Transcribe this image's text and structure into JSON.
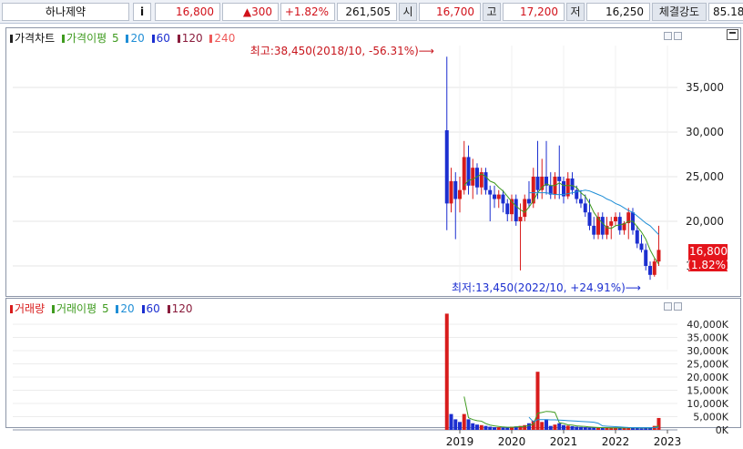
{
  "quote_bar": {
    "stock_name": "하나제약",
    "info_button": "i",
    "price": "16,800",
    "change": "▲300",
    "change_pct": "+1.82%",
    "volume": "261,505",
    "open_label": "시",
    "open": "16,700",
    "high_label": "고",
    "high": "17,200",
    "low_label": "저",
    "low": "16,250",
    "strength_label": "체결강도",
    "strength": "85.18"
  },
  "price_panel": {
    "legend": {
      "chart_label": "가격차트",
      "ma_label": "가격이평",
      "periods": [
        "5",
        "20",
        "60",
        "120",
        "240"
      ]
    },
    "annotations": {
      "high": "최고:38,450(2018/10, -56.31%)⟶",
      "low": "최저:13,450(2022/10, +24.91%)⟶",
      "current_price": "16,800",
      "current_change": "(1.82%)"
    }
  },
  "volume_panel": {
    "legend": {
      "chart_label": "거래량",
      "ma_label": "거래이평",
      "periods": [
        "5",
        "20",
        "60",
        "120"
      ]
    }
  },
  "colors": {
    "up": "#d81c1c",
    "down": "#1c2fd0",
    "ma5": "#3f9b1f",
    "ma20": "#1f8ed6",
    "ma60": "#1c2fd0",
    "ma120": "#8a1c3c",
    "ma240": "#ee5a5a",
    "current_bg": "#e4141b"
  },
  "chart_data": [
    {
      "type": "candlestick",
      "title": "가격차트",
      "x_ticks": [
        "2019",
        "2020",
        "2021",
        "2022",
        "2023"
      ],
      "y_ticks": [
        15000,
        20000,
        25000,
        30000,
        35000
      ],
      "ylim": [
        13000,
        38800
      ],
      "period": "monthly",
      "candles": [
        {
          "t": 2018.75,
          "o": 30200,
          "h": 38450,
          "l": 19000,
          "c": 22000
        },
        {
          "t": 2018.833,
          "o": 22000,
          "h": 26000,
          "l": 21000,
          "c": 24500
        },
        {
          "t": 2018.917,
          "o": 24500,
          "h": 25500,
          "l": 18000,
          "c": 22500
        },
        {
          "t": 2019.0,
          "o": 22500,
          "h": 25000,
          "l": 21000,
          "c": 23500
        },
        {
          "t": 2019.083,
          "o": 23500,
          "h": 29000,
          "l": 23000,
          "c": 27200
        },
        {
          "t": 2019.167,
          "o": 27200,
          "h": 28500,
          "l": 23000,
          "c": 24000
        },
        {
          "t": 2019.25,
          "o": 24000,
          "h": 27000,
          "l": 22500,
          "c": 26000
        },
        {
          "t": 2019.333,
          "o": 26000,
          "h": 26500,
          "l": 23000,
          "c": 23800
        },
        {
          "t": 2019.417,
          "o": 23800,
          "h": 26000,
          "l": 23000,
          "c": 25500
        },
        {
          "t": 2019.5,
          "o": 25500,
          "h": 26000,
          "l": 23000,
          "c": 23500
        },
        {
          "t": 2019.583,
          "o": 23500,
          "h": 24000,
          "l": 20000,
          "c": 23000
        },
        {
          "t": 2019.667,
          "o": 23000,
          "h": 24000,
          "l": 21500,
          "c": 22500
        },
        {
          "t": 2019.75,
          "o": 22500,
          "h": 23500,
          "l": 21500,
          "c": 23000
        },
        {
          "t": 2019.833,
          "o": 23000,
          "h": 23500,
          "l": 21000,
          "c": 22000
        },
        {
          "t": 2019.917,
          "o": 22000,
          "h": 22500,
          "l": 20000,
          "c": 20800
        },
        {
          "t": 2020.0,
          "o": 20800,
          "h": 23000,
          "l": 20000,
          "c": 22500
        },
        {
          "t": 2020.083,
          "o": 22500,
          "h": 23000,
          "l": 19500,
          "c": 20000
        },
        {
          "t": 2020.167,
          "o": 20000,
          "h": 22000,
          "l": 14500,
          "c": 20500
        },
        {
          "t": 2020.25,
          "o": 20500,
          "h": 23000,
          "l": 20000,
          "c": 22500
        },
        {
          "t": 2020.333,
          "o": 22500,
          "h": 24500,
          "l": 21500,
          "c": 22000
        },
        {
          "t": 2020.417,
          "o": 22000,
          "h": 26000,
          "l": 21500,
          "c": 25000
        },
        {
          "t": 2020.5,
          "o": 25000,
          "h": 29000,
          "l": 22500,
          "c": 23500
        },
        {
          "t": 2020.583,
          "o": 23500,
          "h": 27000,
          "l": 22500,
          "c": 25000
        },
        {
          "t": 2020.667,
          "o": 25000,
          "h": 29000,
          "l": 23000,
          "c": 24000
        },
        {
          "t": 2020.75,
          "o": 24000,
          "h": 25500,
          "l": 22500,
          "c": 23000
        },
        {
          "t": 2020.833,
          "o": 23000,
          "h": 25500,
          "l": 22500,
          "c": 25000
        },
        {
          "t": 2020.917,
          "o": 25000,
          "h": 28500,
          "l": 22500,
          "c": 24500
        },
        {
          "t": 2021.0,
          "o": 24500,
          "h": 25000,
          "l": 22000,
          "c": 22800
        },
        {
          "t": 2021.083,
          "o": 22800,
          "h": 25500,
          "l": 22500,
          "c": 24800
        },
        {
          "t": 2021.167,
          "o": 24800,
          "h": 25500,
          "l": 23000,
          "c": 23500
        },
        {
          "t": 2021.25,
          "o": 23500,
          "h": 24000,
          "l": 22000,
          "c": 22500
        },
        {
          "t": 2021.333,
          "o": 22500,
          "h": 23500,
          "l": 21500,
          "c": 22000
        },
        {
          "t": 2021.417,
          "o": 22000,
          "h": 23000,
          "l": 20500,
          "c": 21000
        },
        {
          "t": 2021.5,
          "o": 21000,
          "h": 22500,
          "l": 19000,
          "c": 19500
        },
        {
          "t": 2021.583,
          "o": 19500,
          "h": 20500,
          "l": 18000,
          "c": 18500
        },
        {
          "t": 2021.667,
          "o": 18500,
          "h": 21000,
          "l": 18000,
          "c": 20500
        },
        {
          "t": 2021.75,
          "o": 20500,
          "h": 21000,
          "l": 18000,
          "c": 18500
        },
        {
          "t": 2021.833,
          "o": 18500,
          "h": 20500,
          "l": 18000,
          "c": 19500
        },
        {
          "t": 2021.917,
          "o": 19500,
          "h": 20500,
          "l": 18000,
          "c": 20000
        },
        {
          "t": 2022.0,
          "o": 20000,
          "h": 21000,
          "l": 19500,
          "c": 20500
        },
        {
          "t": 2022.083,
          "o": 20500,
          "h": 21000,
          "l": 18500,
          "c": 19000
        },
        {
          "t": 2022.167,
          "o": 19000,
          "h": 20000,
          "l": 18500,
          "c": 19800
        },
        {
          "t": 2022.25,
          "o": 19800,
          "h": 21500,
          "l": 18000,
          "c": 21000
        },
        {
          "t": 2022.333,
          "o": 21000,
          "h": 21500,
          "l": 18500,
          "c": 19000
        },
        {
          "t": 2022.417,
          "o": 19000,
          "h": 19500,
          "l": 17000,
          "c": 17500
        },
        {
          "t": 2022.5,
          "o": 17500,
          "h": 18500,
          "l": 16500,
          "c": 16800
        },
        {
          "t": 2022.583,
          "o": 16800,
          "h": 17500,
          "l": 14500,
          "c": 15000
        },
        {
          "t": 2022.667,
          "o": 15000,
          "h": 15500,
          "l": 13450,
          "c": 14000
        },
        {
          "t": 2022.75,
          "o": 14000,
          "h": 15800,
          "l": 13800,
          "c": 15500
        },
        {
          "t": 2022.833,
          "o": 15500,
          "h": 19500,
          "l": 15000,
          "c": 16800
        }
      ],
      "moving_averages": [
        {
          "name": "5",
          "values": [
            null,
            null,
            null,
            null,
            24000,
            24600,
            24700,
            25000,
            25300,
            25000,
            24500,
            24300,
            23800,
            23400,
            22800,
            22200,
            21700,
            21300,
            21000,
            21600,
            22300,
            23200,
            23800,
            24200,
            24000,
            24000,
            24300,
            24000,
            24000,
            24000,
            23800,
            23200,
            22800,
            22000,
            21000,
            20300,
            19800,
            19300,
            19200,
            19500,
            19600,
            19700,
            20000,
            20000,
            19400,
            18800,
            18000,
            16800,
            15900,
            15200
          ]
        },
        {
          "name": "20",
          "values": [
            null,
            null,
            null,
            null,
            null,
            null,
            null,
            null,
            null,
            null,
            null,
            null,
            null,
            null,
            null,
            null,
            null,
            null,
            null,
            23200,
            23200,
            23200,
            23200,
            23200,
            23100,
            23000,
            23000,
            23000,
            23100,
            23200,
            23300,
            23400,
            23500,
            23400,
            23200,
            23000,
            22800,
            22500,
            22300,
            22000,
            21800,
            21500,
            21200,
            21000,
            20600,
            20200,
            19800,
            19500,
            19000,
            18500
          ]
        },
        {
          "name": "60",
          "values": []
        },
        {
          "name": "120",
          "values": []
        },
        {
          "name": "240",
          "values": []
        }
      ]
    },
    {
      "type": "bar",
      "title": "거래량",
      "x_ticks": [
        "2019",
        "2020",
        "2021",
        "2022",
        "2023"
      ],
      "y_ticks": [
        "0K",
        "5,000K",
        "10,000K",
        "15,000K",
        "20,000K",
        "25,000K",
        "30,000K",
        "35,000K",
        "40,000K"
      ],
      "ylim": [
        0,
        45000
      ],
      "unit": "K",
      "bars": [
        {
          "t": 2018.75,
          "v": 44000,
          "up": true
        },
        {
          "t": 2018.833,
          "v": 6000,
          "up": false
        },
        {
          "t": 2018.917,
          "v": 4000,
          "up": false
        },
        {
          "t": 2019.0,
          "v": 3000,
          "up": false
        },
        {
          "t": 2019.083,
          "v": 6000,
          "up": true
        },
        {
          "t": 2019.167,
          "v": 4000,
          "up": false
        },
        {
          "t": 2019.25,
          "v": 2500,
          "up": false
        },
        {
          "t": 2019.333,
          "v": 2000,
          "up": false
        },
        {
          "t": 2019.417,
          "v": 1800,
          "up": true
        },
        {
          "t": 2019.5,
          "v": 1500,
          "up": false
        },
        {
          "t": 2019.583,
          "v": 1200,
          "up": false
        },
        {
          "t": 2019.667,
          "v": 1000,
          "up": false
        },
        {
          "t": 2019.75,
          "v": 1000,
          "up": true
        },
        {
          "t": 2019.833,
          "v": 900,
          "up": false
        },
        {
          "t": 2019.917,
          "v": 900,
          "up": false
        },
        {
          "t": 2020.0,
          "v": 1200,
          "up": true
        },
        {
          "t": 2020.083,
          "v": 1300,
          "up": false
        },
        {
          "t": 2020.167,
          "v": 1500,
          "up": true
        },
        {
          "t": 2020.25,
          "v": 1800,
          "up": true
        },
        {
          "t": 2020.333,
          "v": 2500,
          "up": false
        },
        {
          "t": 2020.417,
          "v": 3500,
          "up": true
        },
        {
          "t": 2020.5,
          "v": 22000,
          "up": true
        },
        {
          "t": 2020.583,
          "v": 3000,
          "up": true
        },
        {
          "t": 2020.667,
          "v": 4000,
          "up": false
        },
        {
          "t": 2020.75,
          "v": 1500,
          "up": false
        },
        {
          "t": 2020.833,
          "v": 2000,
          "up": true
        },
        {
          "t": 2020.917,
          "v": 2500,
          "up": false
        },
        {
          "t": 2021.0,
          "v": 1800,
          "up": false
        },
        {
          "t": 2021.083,
          "v": 1600,
          "up": true
        },
        {
          "t": 2021.167,
          "v": 1400,
          "up": false
        },
        {
          "t": 2021.25,
          "v": 1200,
          "up": false
        },
        {
          "t": 2021.333,
          "v": 1100,
          "up": false
        },
        {
          "t": 2021.417,
          "v": 1000,
          "up": false
        },
        {
          "t": 2021.5,
          "v": 900,
          "up": false
        },
        {
          "t": 2021.583,
          "v": 900,
          "up": false
        },
        {
          "t": 2021.667,
          "v": 800,
          "up": true
        },
        {
          "t": 2021.75,
          "v": 800,
          "up": false
        },
        {
          "t": 2021.833,
          "v": 700,
          "up": true
        },
        {
          "t": 2021.917,
          "v": 700,
          "up": true
        },
        {
          "t": 2022.0,
          "v": 800,
          "up": true
        },
        {
          "t": 2022.083,
          "v": 700,
          "up": false
        },
        {
          "t": 2022.167,
          "v": 800,
          "up": true
        },
        {
          "t": 2022.25,
          "v": 900,
          "up": true
        },
        {
          "t": 2022.333,
          "v": 800,
          "up": false
        },
        {
          "t": 2022.417,
          "v": 700,
          "up": false
        },
        {
          "t": 2022.5,
          "v": 600,
          "up": false
        },
        {
          "t": 2022.583,
          "v": 700,
          "up": false
        },
        {
          "t": 2022.667,
          "v": 900,
          "up": false
        },
        {
          "t": 2022.75,
          "v": 1500,
          "up": true
        },
        {
          "t": 2022.833,
          "v": 4500,
          "up": true
        }
      ],
      "moving_averages": [
        {
          "name": "5",
          "values": [
            null,
            null,
            null,
            null,
            12600,
            4600,
            3900,
            3500,
            3300,
            2400,
            1800,
            1500,
            1300,
            1100,
            1000,
            1000,
            1100,
            1200,
            1300,
            1700,
            2100,
            6300,
            6600,
            7000,
            6900,
            6600,
            2700,
            2400,
            1900,
            1800,
            1500,
            1400,
            1300,
            1100,
            1000,
            900,
            800,
            800,
            750,
            750,
            740,
            740,
            780,
            800,
            780,
            760,
            740,
            740,
            880,
            1640
          ]
        },
        {
          "name": "20",
          "values": [
            null,
            null,
            null,
            null,
            null,
            null,
            null,
            null,
            null,
            null,
            null,
            null,
            null,
            null,
            null,
            null,
            null,
            null,
            null,
            4800,
            3000,
            3900,
            3900,
            3900,
            3800,
            3800,
            3700,
            3600,
            3500,
            3400,
            3300,
            3200,
            3100,
            3000,
            2900,
            2500,
            1500,
            1400,
            1300,
            1200,
            1100,
            1000,
            900,
            850,
            800,
            800,
            800,
            800,
            850,
            1000
          ]
        },
        {
          "name": "60",
          "values": []
        },
        {
          "name": "120",
          "values": []
        }
      ]
    }
  ]
}
